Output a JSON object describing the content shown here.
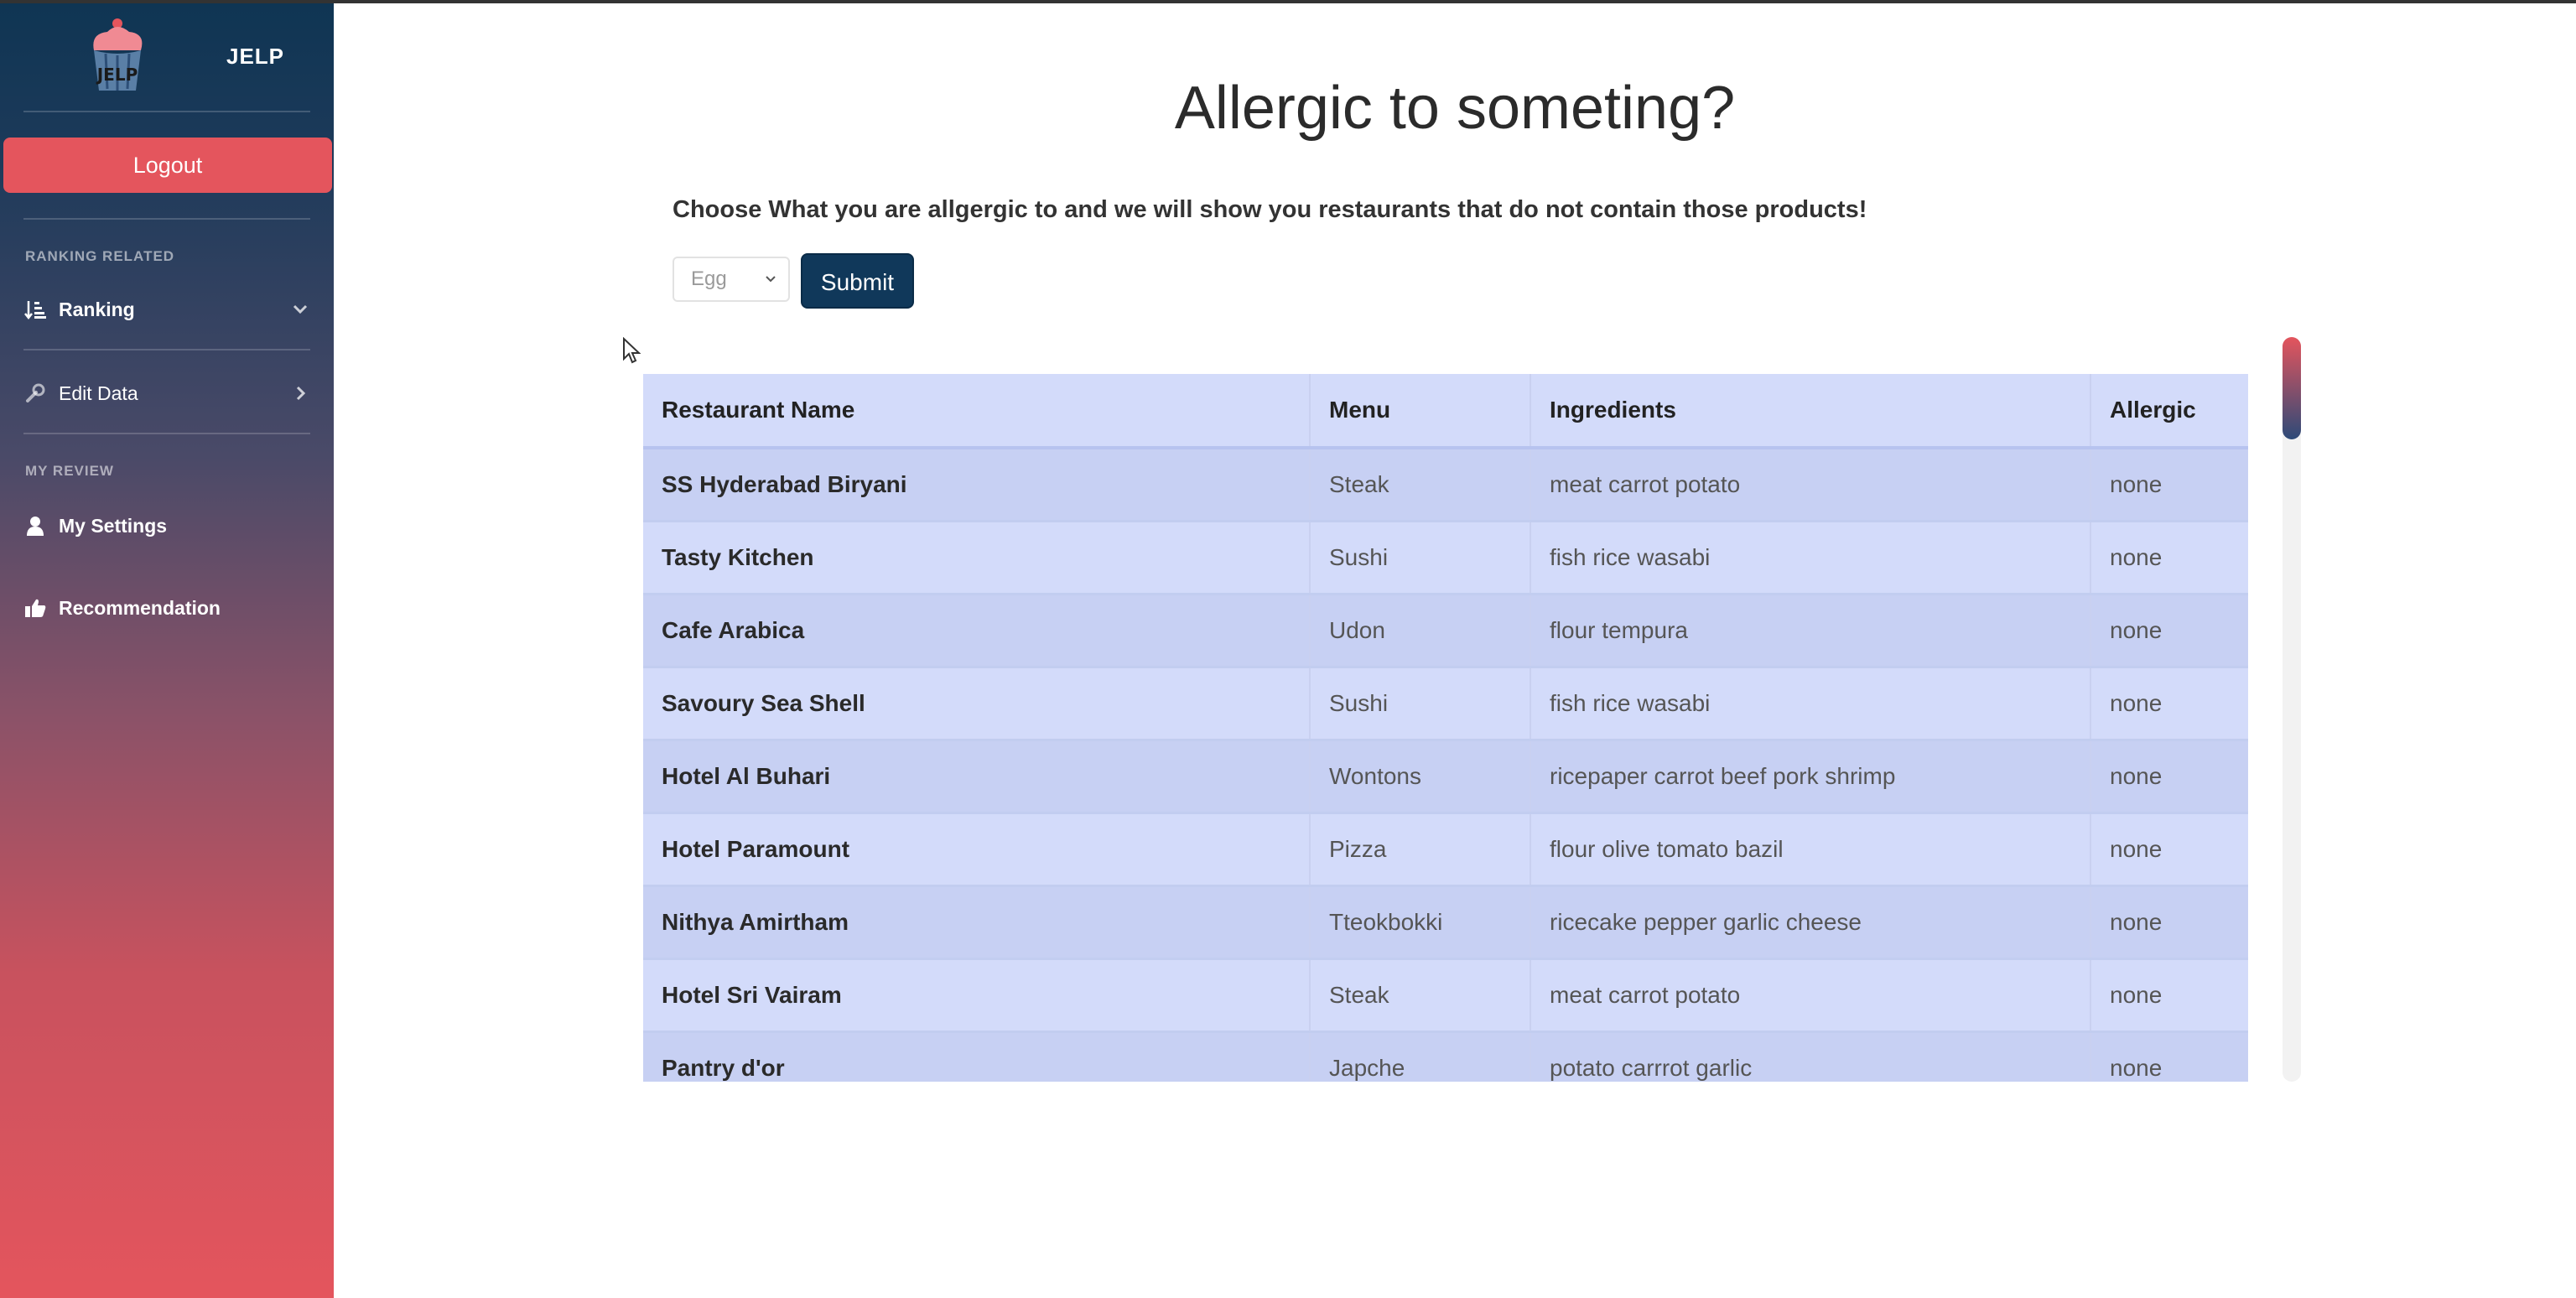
{
  "sidebar": {
    "brand_name": "JELP",
    "logo_text": "JELP",
    "logout_label": "Logout",
    "sections": [
      {
        "heading": "RANKING RELATED"
      },
      {
        "heading": "MY REVIEW"
      }
    ],
    "items": [
      {
        "label": "Ranking",
        "icon": "sort-icon",
        "chevron": "chevron-down-icon"
      },
      {
        "label": "Edit Data",
        "icon": "wrench-icon",
        "chevron": "chevron-right-icon"
      },
      {
        "label": "My Settings",
        "icon": "user-icon"
      },
      {
        "label": "Recommendation",
        "icon": "thumbs-up-icon"
      }
    ]
  },
  "main": {
    "title": "Allergic to someting?",
    "instruction": "Choose What you are allgergic to and we will show you restaurants that do not contain those products!",
    "allergen_select": {
      "selected": "Egg"
    },
    "submit_label": "Submit"
  },
  "table": {
    "columns": [
      "Restaurant Name",
      "Menu",
      "Ingredients",
      "Allergic"
    ],
    "rows": [
      [
        "SS Hyderabad Biryani",
        "Steak",
        "meat carrot potato",
        "none"
      ],
      [
        "Tasty Kitchen",
        "Sushi",
        "fish rice wasabi",
        "none"
      ],
      [
        "Cafe Arabica",
        "Udon",
        "flour tempura",
        "none"
      ],
      [
        "Savoury Sea Shell",
        "Sushi",
        "fish rice wasabi",
        "none"
      ],
      [
        "Hotel Al Buhari",
        "Wontons",
        "ricepaper carrot beef pork shrimp",
        "none"
      ],
      [
        "Hotel Paramount",
        "Pizza",
        "flour olive tomato bazil",
        "none"
      ],
      [
        "Nithya Amirtham",
        "Tteokbokki",
        "ricecake pepper garlic cheese",
        "none"
      ],
      [
        "Hotel Sri Vairam",
        "Steak",
        "meat carrot potato",
        "none"
      ],
      [
        "Pantry d'or",
        "Japche",
        "potato carrrot garlic",
        "none"
      ]
    ]
  },
  "colors": {
    "sidebar_top": "#0f3553",
    "sidebar_bottom": "#e4555d",
    "accent": "#e4555d",
    "submit": "#10385a",
    "table_row_a": "#c7d0f3",
    "table_row_b": "#d3dbfa"
  }
}
